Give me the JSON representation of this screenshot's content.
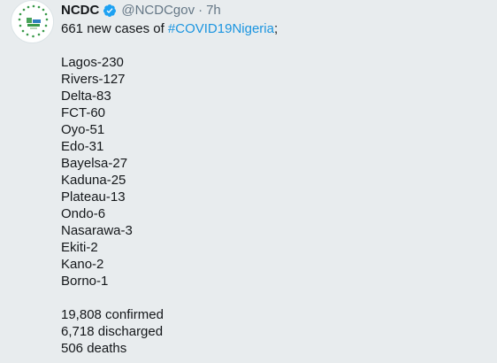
{
  "account": {
    "name": "NCDC",
    "handle": "@NCDCgov",
    "separator": "·",
    "time": "7h",
    "verified_color": "#1da1f2"
  },
  "tweet": {
    "intro_text": "661 new cases of ",
    "hashtag": "#COVID19Nigeria",
    "intro_suffix": ";",
    "states": [
      "Lagos-230",
      "Rivers-127",
      "Delta-83",
      "FCT-60",
      "Oyo-51",
      "Edo-31",
      "Bayelsa-27",
      "Kaduna-25",
      "Plateau-13",
      "Ondo-6",
      "Nasarawa-3",
      "Ekiti-2",
      "Kano-2",
      "Borno-1"
    ],
    "totals": [
      "19,808 confirmed",
      "6,718 discharged",
      "506 deaths"
    ]
  },
  "colors": {
    "background": "#e8ecee",
    "text": "#14171a",
    "muted": "#657786",
    "link": "#1b95e0"
  }
}
